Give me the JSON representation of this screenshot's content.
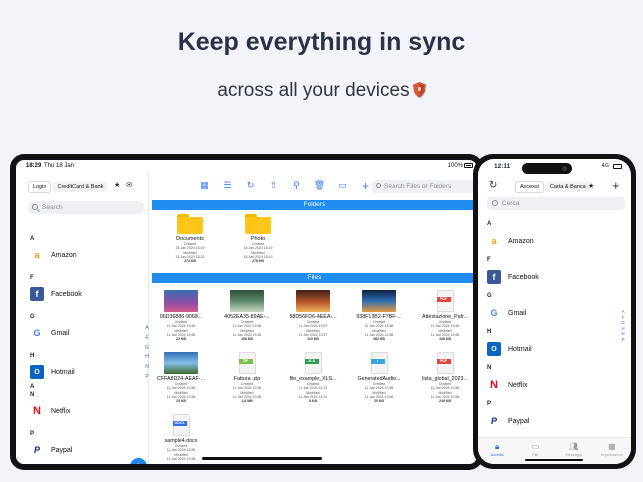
{
  "headline": "Keep everything in sync",
  "subline": "across all your devices",
  "tablet": {
    "status": {
      "time": "18:29",
      "date": "Thu 18 Jan",
      "battery": "100%"
    },
    "sidebar": {
      "segments": [
        "Login",
        "CreditCard & Bank"
      ],
      "search_placeholder": "Search",
      "sections": [
        {
          "letter": "A",
          "item": "Amazon",
          "icon": "amazon-icon"
        },
        {
          "letter": "F",
          "item": "Facebook",
          "icon": "facebook-icon"
        },
        {
          "letter": "G",
          "item": "Gmail",
          "icon": "google-icon"
        },
        {
          "letter": "H",
          "item": "Hotmail",
          "icon": "outlook-icon"
        },
        {
          "letter": "N",
          "item": "Netflix",
          "icon": "netflix-icon"
        },
        {
          "letter": "P",
          "item": "Paypal",
          "icon": "paypal-icon"
        }
      ],
      "index_letters": [
        "A",
        "F",
        "G",
        "H",
        "N",
        "P"
      ]
    },
    "main": {
      "search_placeholder": "Search Files or Folders",
      "folders_header": "Folders",
      "files_header": "Files",
      "folders": [
        {
          "name": "Documents",
          "l1": "Created",
          "l2": "18 Jan 2024 18:19",
          "l3": "Modified",
          "l4": "18 Jan 2024 18:23",
          "size": "274 KB"
        },
        {
          "name": "Photo",
          "l1": "Created",
          "l2": "18 Jan 2024 18:19",
          "l3": "Modified",
          "l4": "18 Jan 2024 18:19",
          "size": "278 KB"
        }
      ],
      "files": [
        {
          "name": "06D36886-9068...",
          "kind": "image",
          "l1": "Created",
          "l2": "11 Jan 2024 13:56",
          "l3": "Modified",
          "l4": "11 Jan 2024 13:56",
          "size": "22 KB"
        },
        {
          "name": "4052EA35-89AE-...",
          "kind": "image",
          "l1": "Created",
          "l2": "11 Jan 2024 13:56",
          "l3": "Modified",
          "l4": "11 Jan 2024 13:56",
          "size": "106 KB"
        },
        {
          "name": "58D56FD6-4EEA-...",
          "kind": "image",
          "l1": "Created",
          "l2": "11 Jan 2024 13:57",
          "l3": "Modified",
          "l4": "11 Jan 2024 13:57",
          "size": "119 KB"
        },
        {
          "name": "938F13B2-F7BF-...",
          "kind": "image",
          "l1": "Created",
          "l2": "11 Jan 2024 13:56",
          "l3": "Modified",
          "l4": "11 Jan 2024 13:56",
          "size": "382 KB"
        },
        {
          "name": "Attestazione_Pafr...",
          "kind": "pdf",
          "tag": "PDF",
          "l1": "Created",
          "l2": "11 Jan 2024 13:56",
          "l3": "Modified",
          "l4": "11 Jan 2024 13:56",
          "size": "336 KB"
        },
        {
          "name": "CFFA8D24-AEAF-...",
          "kind": "image",
          "l1": "Created",
          "l2": "11 Jan 2024 13:56",
          "l3": "Modified",
          "l4": "11 Jan 2024 13:56",
          "size": "24 KB"
        },
        {
          "name": "Fattura .zip",
          "kind": "zip",
          "tag": "ZIP",
          "l1": "Created",
          "l2": "11 Jan 2024 13:56",
          "l3": "Modified",
          "l4": "11 Jan 2024 13:56",
          "size": "1,8 MB"
        },
        {
          "name": "file_example_XLS...",
          "kind": "xls",
          "tag": "XLS",
          "l1": "Created",
          "l2": "11 Jan 2024 14:12",
          "l3": "Modified",
          "l4": "11 Jan 2024 14:12",
          "size": "8 KB"
        },
        {
          "name": "GeneratedAudio...",
          "kind": "audio",
          "tag": "♪",
          "l1": "Created",
          "l2": "11 Jan 2024 13:56",
          "l3": "Modified",
          "l4": "11 Jan 2024 13:56",
          "size": "20 KB"
        },
        {
          "name": "lista_global_2023...",
          "kind": "pdf",
          "tag": "PDF",
          "l1": "Created",
          "l2": "11 Jan 2024 13:56",
          "l3": "Modified",
          "l4": "11 Jan 2024 13:56",
          "size": "249 KB"
        },
        {
          "name": "sample4.docx",
          "kind": "docx",
          "tag": "DOCX",
          "l1": "Created",
          "l2": "11 Jan 2024 13:56",
          "l3": "Modified",
          "l4": "11 Jan 2024 13:56",
          "size": ""
        }
      ]
    }
  },
  "phone": {
    "status": {
      "time": "12:11",
      "signal": "4G"
    },
    "segments": [
      "Accessi",
      "Carta & Banca"
    ],
    "search_placeholder": "Cerca",
    "sections": [
      {
        "letter": "A",
        "item": "Amazon",
        "icon": "amazon-icon"
      },
      {
        "letter": "F",
        "item": "Facebook",
        "icon": "facebook-icon"
      },
      {
        "letter": "G",
        "item": "Gmail",
        "icon": "google-icon"
      },
      {
        "letter": "H",
        "item": "Hotmail",
        "icon": "outlook-icon"
      },
      {
        "letter": "N",
        "item": "Netflix",
        "icon": "netflix-icon"
      },
      {
        "letter": "P",
        "item": "Paypal",
        "icon": "paypal-icon"
      }
    ],
    "index_letters": [
      "A",
      "F",
      "G",
      "H",
      "N",
      "P"
    ],
    "tabs": [
      {
        "label": "Accessi",
        "icon": "lock-icon",
        "active": true
      },
      {
        "label": "File",
        "icon": "folder-icon",
        "active": false
      },
      {
        "label": "Messaggi",
        "icon": "people-icon",
        "active": false
      },
      {
        "label": "Impostazioni",
        "icon": "grid-icon",
        "active": false
      }
    ]
  },
  "colors": {
    "accent": "#1e8cf1",
    "headline": "#2b3247",
    "folder": "#ffc61a"
  }
}
